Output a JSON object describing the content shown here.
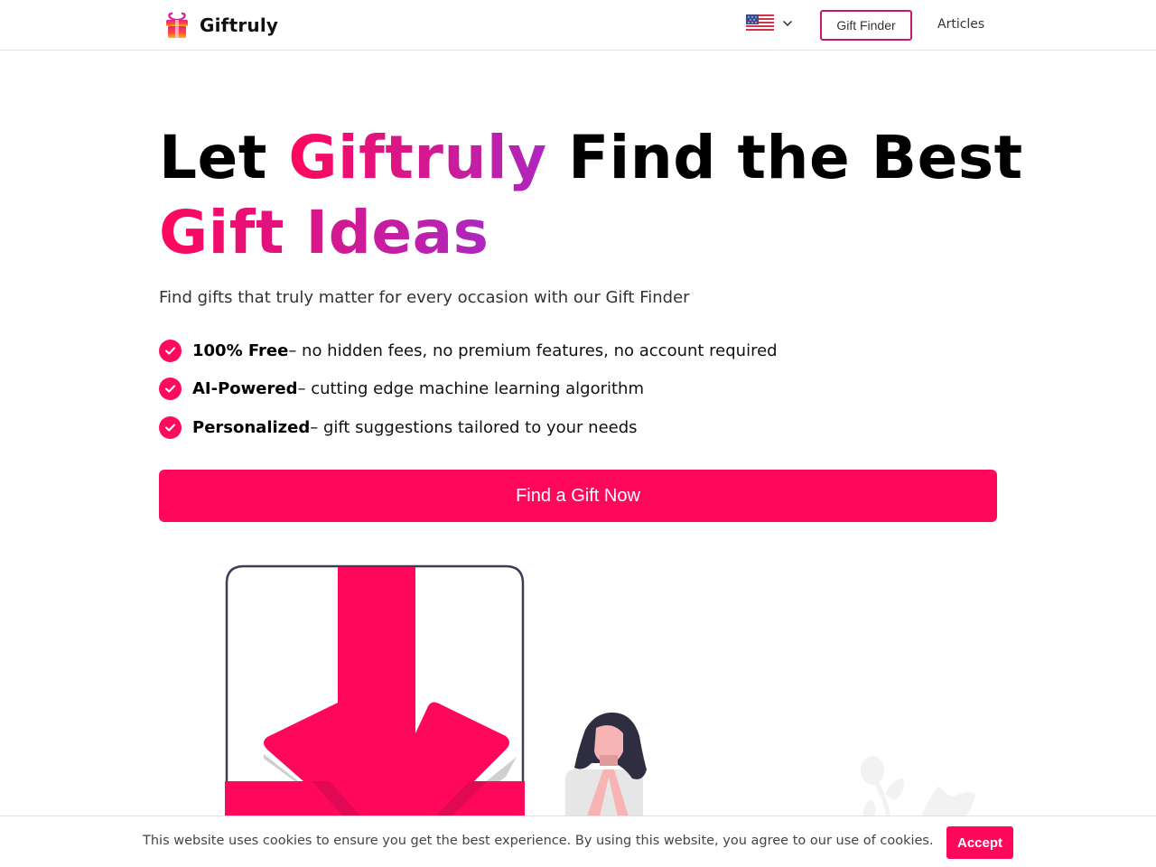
{
  "nav": {
    "brand": "Giftruly",
    "language_flag": "us-flag-icon",
    "gift_finder_label": "Gift Finder",
    "articles_label": "Articles"
  },
  "hero": {
    "title_part1": "Let ",
    "title_highlight1": "Giftruly",
    "title_part2": " Find the Best ",
    "title_highlight2": "Gift Ideas",
    "subtitle": "Find gifts that truly matter for every occasion with our Gift Finder",
    "features": [
      {
        "bold": "100% Free",
        "desc": " – no hidden fees, no premium features, no account required"
      },
      {
        "bold": "AI-Powered",
        "desc": " – cutting edge machine learning algorithm"
      },
      {
        "bold": "Personalized",
        "desc": " – gift suggestions tailored to your needs"
      }
    ],
    "cta_label": "Find a Gift Now"
  },
  "cookie": {
    "text": "This website uses cookies to ensure you get the best experience. By using this website, you agree to our use of cookies.",
    "accept_label": "Accept"
  },
  "colors": {
    "accent": "#ff085b",
    "gradient_end": "#ad27bf",
    "nav_button_border": "#c4196d"
  }
}
